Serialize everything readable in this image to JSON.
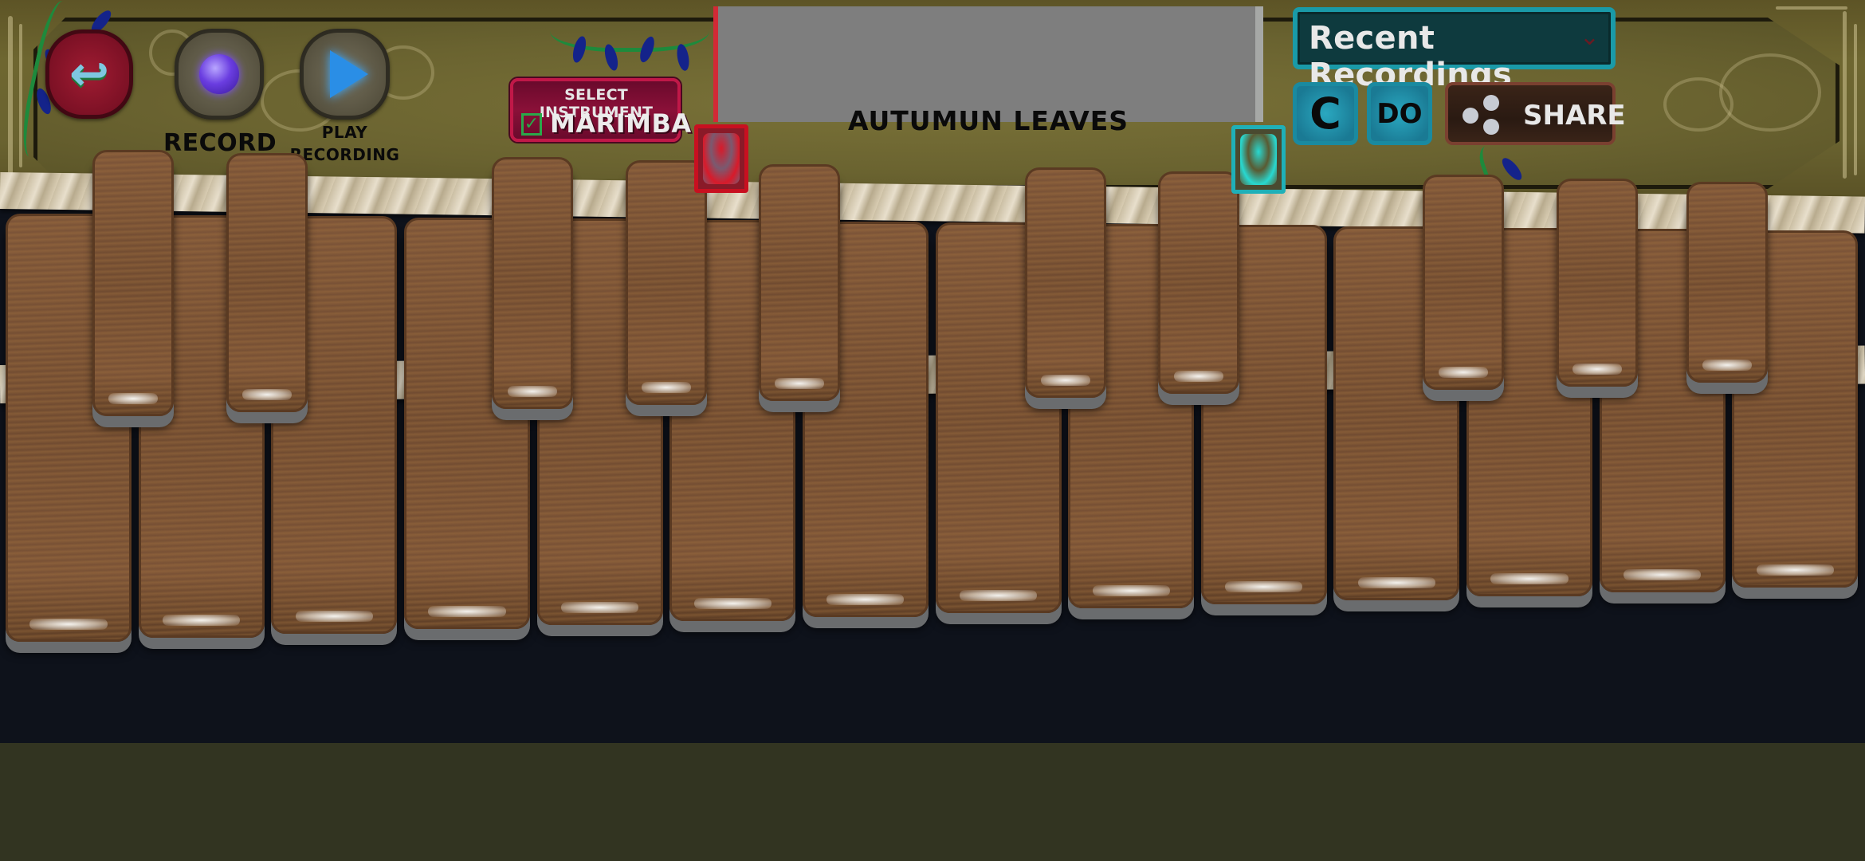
{
  "app": {
    "name": "Marimba"
  },
  "header": {
    "back_button": {
      "icon": "back-arrow-icon",
      "glyph": "↩"
    },
    "record_button": {
      "label": "RECORD",
      "icon": "record-gem-icon"
    },
    "play_button": {
      "label_line1": "PLAY",
      "label_line2": "RECORDING",
      "icon": "play-gem-icon"
    },
    "select_instrument": {
      "title": "SELECT INSTRUMENT",
      "value": "MARIMBA",
      "check_glyph": "✓"
    },
    "song": {
      "title": "AUTUMUN LEAVES"
    },
    "recent_recordings": {
      "label": "Recent Recordings",
      "caret": "⌄"
    },
    "note_buttons": [
      {
        "label": "C"
      },
      {
        "label": "DO"
      }
    ],
    "share_button": {
      "label": "SHARE",
      "icon": "share-icon"
    }
  },
  "scroll_tabs": {
    "left": {
      "icon": "left-scroll-tab-icon",
      "color": "#c81020"
    },
    "right": {
      "icon": "right-scroll-tab-icon",
      "color": "#1fb0b8"
    }
  },
  "keyboard": {
    "white_key_count": 14,
    "black_key_count": 10,
    "colors": {
      "wood": "#6f4a30",
      "rope": "#d8ccb2",
      "background": "#0e121b",
      "frame": "#6a6330"
    }
  }
}
